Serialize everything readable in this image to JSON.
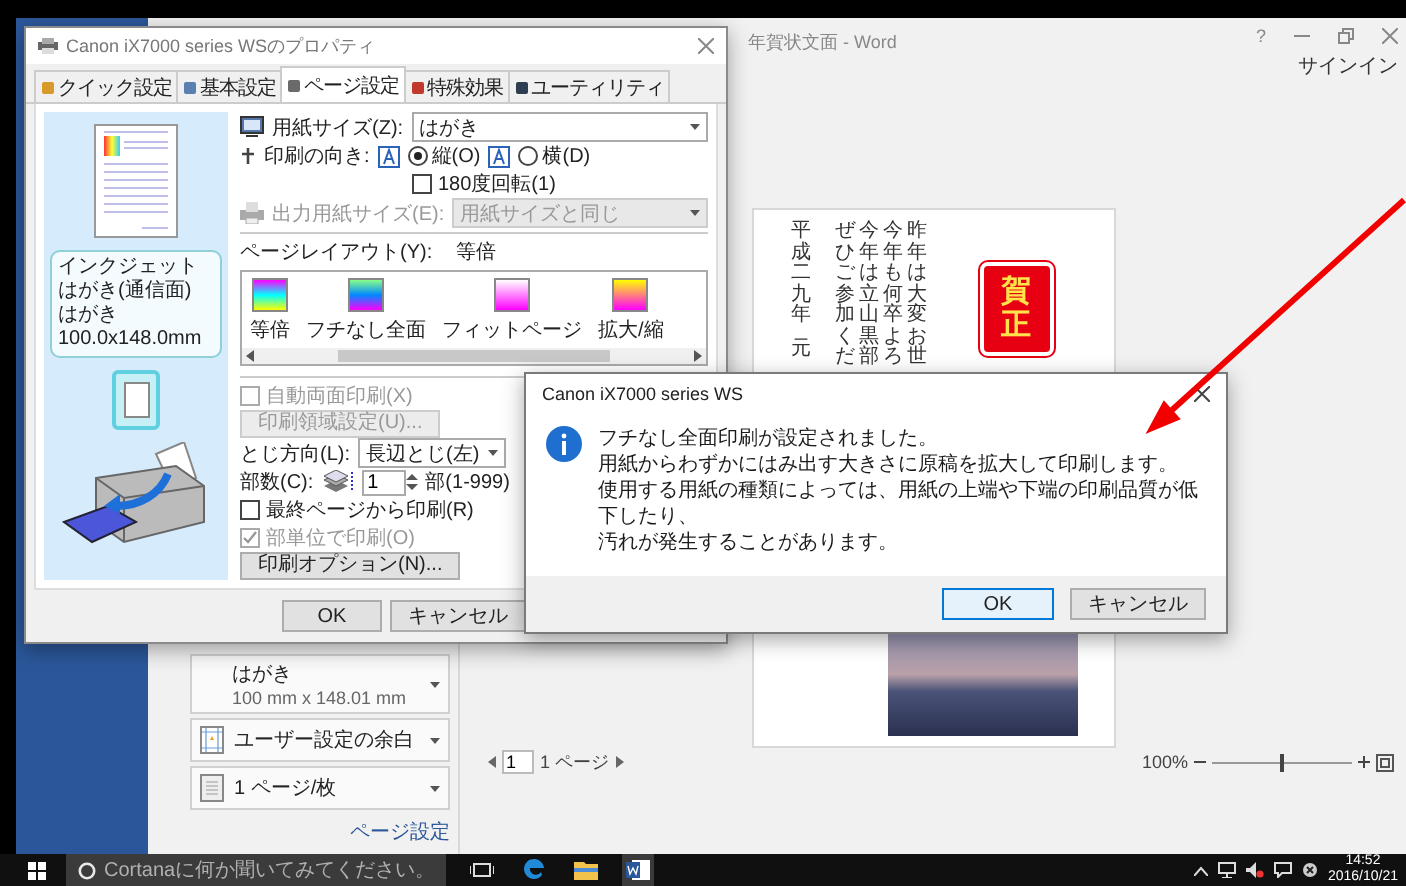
{
  "word_window": {
    "title": "年賀状文面 - Word",
    "help": "?",
    "sign_in": "サインイン",
    "print_settings": [
      {
        "kind": "paper",
        "label": "はがき",
        "detail": "100 mm x 148.01 mm"
      },
      {
        "kind": "margins",
        "label": "ユーザー設定の余白"
      },
      {
        "kind": "pages",
        "label": "1 ページ/枚"
      }
    ],
    "page_setup_link": "ページ設定",
    "preview": {
      "stamp": "賀正",
      "columns": [
        [
          "平成二九年",
          "元"
        ],
        [
          "ぜひご参加くだ"
        ],
        [
          "今年は立山黒部"
        ],
        [
          "今年も何卒よろ"
        ],
        [
          "昨年は大変お世"
        ]
      ]
    },
    "page_nav": {
      "page": "1",
      "total": "1 ページ"
    },
    "zoom": {
      "label": "100%",
      "level": 0.5
    }
  },
  "properties_dialog": {
    "title": "Canon iX7000 series WSのプロパティ",
    "tabs": [
      {
        "label": "クイック設定",
        "selected": false
      },
      {
        "label": "基本設定",
        "selected": false
      },
      {
        "label": "ページ設定",
        "selected": true
      },
      {
        "label": "特殊効果",
        "selected": false
      },
      {
        "label": "ユーティリティ",
        "selected": false
      }
    ],
    "preview_labels": [
      "インクジェットはがき(通信面)",
      "はがき 100.0x148.0mm"
    ],
    "paper_size": {
      "label": "用紙サイズ(Z):",
      "value": "はがき"
    },
    "orientation": {
      "label": "印刷の向き:",
      "options": [
        {
          "label": "縦(O)",
          "selected": true
        },
        {
          "label": "横(D)",
          "selected": false
        }
      ]
    },
    "rotate180": {
      "label": "180度回転(1)",
      "checked": false
    },
    "output_size": {
      "label": "出力用紙サイズ(E):",
      "value": "用紙サイズと同じ",
      "disabled": true
    },
    "layout": {
      "label": "ページレイアウト(Y):",
      "value": "等倍",
      "items": [
        "等倍",
        "フチなし全面",
        "フィットページ",
        "拡大/縮"
      ]
    },
    "duplex": {
      "label": "自動両面印刷(X)",
      "checked": false,
      "disabled": true
    },
    "print_area_button": {
      "label": "印刷領域設定(U)...",
      "disabled": true
    },
    "binding": {
      "label": "とじ方向(L):",
      "value": "長辺とじ(左)"
    },
    "copies": {
      "label": "部数(C):",
      "value": "1",
      "range": "部(1-999)"
    },
    "reverse_order": {
      "label": "最終ページから印刷(R)",
      "checked": false
    },
    "collate": {
      "label": "部単位で印刷(O)",
      "checked": true,
      "disabled": true
    },
    "options_button": "印刷オプション(N)...",
    "buttons": [
      "OK",
      "キャンセル"
    ]
  },
  "message_box": {
    "title": "Canon iX7000 series WS",
    "lines": [
      "フチなし全面印刷が設定されました。",
      "用紙からわずかにはみ出す大きさに原稿を拡大して印刷します。",
      "使用する用紙の種類によっては、用紙の上端や下端の印刷品質が低下したり、",
      "汚れが発生することがあります。"
    ],
    "buttons": [
      {
        "label": "OK",
        "default": true
      },
      {
        "label": "キャンセル",
        "default": false
      }
    ]
  },
  "taskbar": {
    "search_placeholder": "Cortanaに何か聞いてみてください。",
    "apps": [
      {
        "kind": "task-view",
        "active": false
      },
      {
        "kind": "edge",
        "active": false
      },
      {
        "kind": "explorer",
        "active": false
      },
      {
        "kind": "word",
        "active": true
      }
    ],
    "time": "14:52",
    "date": "2016/10/21"
  }
}
